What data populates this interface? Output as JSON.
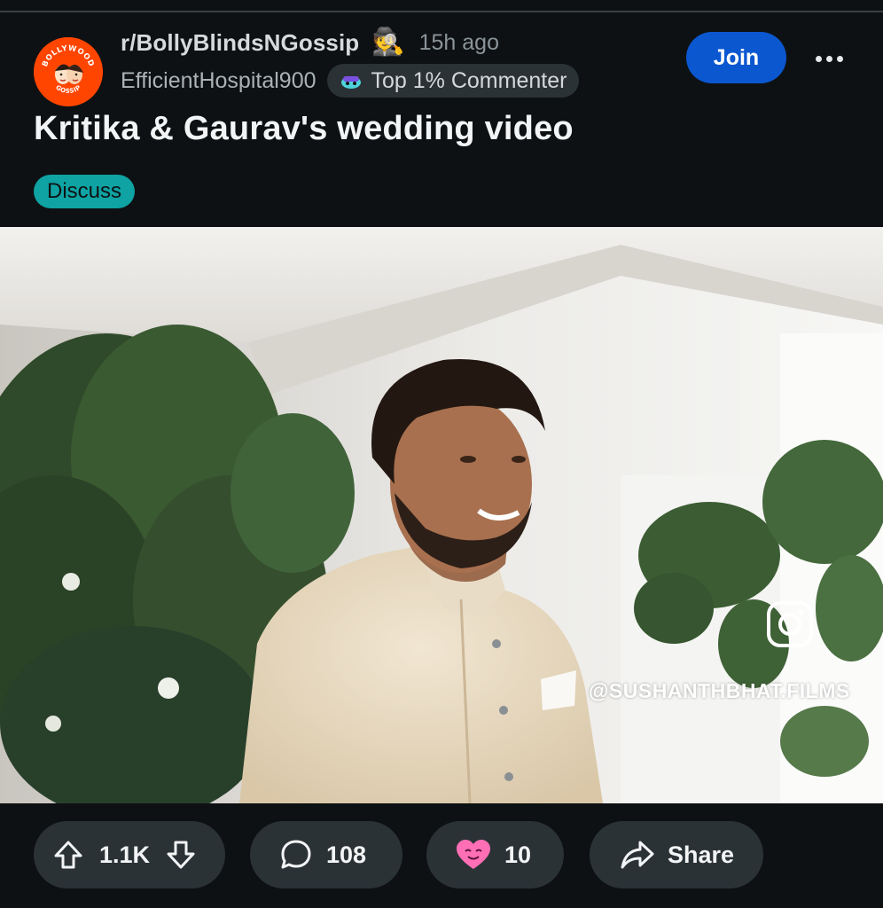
{
  "post": {
    "subreddit": "r/BollyBlindsNGossip",
    "subreddit_icon_text": [
      "BOLLYWOOD",
      "GOSSIP"
    ],
    "subreddit_emoji": "🕵️",
    "time_ago": "15h ago",
    "username": "EfficientHospital900",
    "user_flair": "Top 1% Commenter",
    "join_label": "Join",
    "more_icon": "more-horizontal-icon",
    "title": "Kritika & Gaurav's wedding video",
    "tag": "Discuss",
    "media": {
      "watermark": "@SUSHANTHBHAT.FILMS",
      "watermark_icon": "instagram-icon"
    }
  },
  "actions": {
    "upvote_count": "1.1K",
    "comment_count": "108",
    "award_count": "10",
    "share_label": "Share"
  },
  "colors": {
    "background": "#0e1113",
    "join_button": "#0b57d0",
    "tag": "#0fa3a3",
    "pill": "#2b3236",
    "subreddit_avatar": "#ff4500"
  }
}
